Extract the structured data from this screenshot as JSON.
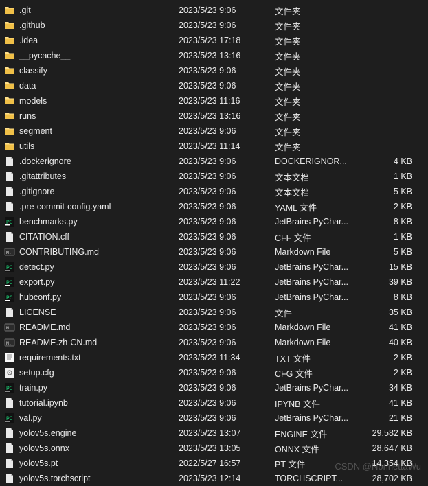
{
  "icons": {
    "folder": "folder",
    "file": "file",
    "pycharm": "pycharm",
    "markdown": "markdown",
    "text": "text",
    "config": "config"
  },
  "watermark": "CSDN @NonnettaWu",
  "rows": [
    {
      "icon": "folder",
      "name": ".git",
      "date": "2023/5/23 9:06",
      "type": "文件夹",
      "size": ""
    },
    {
      "icon": "folder",
      "name": ".github",
      "date": "2023/5/23 9:06",
      "type": "文件夹",
      "size": ""
    },
    {
      "icon": "folder",
      "name": ".idea",
      "date": "2023/5/23 17:18",
      "type": "文件夹",
      "size": ""
    },
    {
      "icon": "folder",
      "name": "__pycache__",
      "date": "2023/5/23 13:16",
      "type": "文件夹",
      "size": ""
    },
    {
      "icon": "folder",
      "name": "classify",
      "date": "2023/5/23 9:06",
      "type": "文件夹",
      "size": ""
    },
    {
      "icon": "folder",
      "name": "data",
      "date": "2023/5/23 9:06",
      "type": "文件夹",
      "size": ""
    },
    {
      "icon": "folder",
      "name": "models",
      "date": "2023/5/23 11:16",
      "type": "文件夹",
      "size": ""
    },
    {
      "icon": "folder",
      "name": "runs",
      "date": "2023/5/23 13:16",
      "type": "文件夹",
      "size": ""
    },
    {
      "icon": "folder",
      "name": "segment",
      "date": "2023/5/23 9:06",
      "type": "文件夹",
      "size": ""
    },
    {
      "icon": "folder",
      "name": "utils",
      "date": "2023/5/23 11:14",
      "type": "文件夹",
      "size": ""
    },
    {
      "icon": "file",
      "name": ".dockerignore",
      "date": "2023/5/23 9:06",
      "type": "DOCKERIGNOR...",
      "size": "4 KB"
    },
    {
      "icon": "file",
      "name": ".gitattributes",
      "date": "2023/5/23 9:06",
      "type": "文本文档",
      "size": "1 KB"
    },
    {
      "icon": "file",
      "name": ".gitignore",
      "date": "2023/5/23 9:06",
      "type": "文本文档",
      "size": "5 KB"
    },
    {
      "icon": "file",
      "name": ".pre-commit-config.yaml",
      "date": "2023/5/23 9:06",
      "type": "YAML 文件",
      "size": "2 KB"
    },
    {
      "icon": "pycharm",
      "name": "benchmarks.py",
      "date": "2023/5/23 9:06",
      "type": "JetBrains PyChar...",
      "size": "8 KB"
    },
    {
      "icon": "file",
      "name": "CITATION.cff",
      "date": "2023/5/23 9:06",
      "type": "CFF 文件",
      "size": "1 KB"
    },
    {
      "icon": "markdown",
      "name": "CONTRIBUTING.md",
      "date": "2023/5/23 9:06",
      "type": "Markdown File",
      "size": "5 KB"
    },
    {
      "icon": "pycharm",
      "name": "detect.py",
      "date": "2023/5/23 9:06",
      "type": "JetBrains PyChar...",
      "size": "15 KB"
    },
    {
      "icon": "pycharm",
      "name": "export.py",
      "date": "2023/5/23 11:22",
      "type": "JetBrains PyChar...",
      "size": "39 KB"
    },
    {
      "icon": "pycharm",
      "name": "hubconf.py",
      "date": "2023/5/23 9:06",
      "type": "JetBrains PyChar...",
      "size": "8 KB"
    },
    {
      "icon": "file",
      "name": "LICENSE",
      "date": "2023/5/23 9:06",
      "type": "文件",
      "size": "35 KB"
    },
    {
      "icon": "markdown",
      "name": "README.md",
      "date": "2023/5/23 9:06",
      "type": "Markdown File",
      "size": "41 KB"
    },
    {
      "icon": "markdown",
      "name": "README.zh-CN.md",
      "date": "2023/5/23 9:06",
      "type": "Markdown File",
      "size": "40 KB"
    },
    {
      "icon": "text",
      "name": "requirements.txt",
      "date": "2023/5/23 11:34",
      "type": "TXT 文件",
      "size": "2 KB"
    },
    {
      "icon": "config",
      "name": "setup.cfg",
      "date": "2023/5/23 9:06",
      "type": "CFG 文件",
      "size": "2 KB"
    },
    {
      "icon": "pycharm",
      "name": "train.py",
      "date": "2023/5/23 9:06",
      "type": "JetBrains PyChar...",
      "size": "34 KB"
    },
    {
      "icon": "file",
      "name": "tutorial.ipynb",
      "date": "2023/5/23 9:06",
      "type": "IPYNB 文件",
      "size": "41 KB"
    },
    {
      "icon": "pycharm",
      "name": "val.py",
      "date": "2023/5/23 9:06",
      "type": "JetBrains PyChar...",
      "size": "21 KB"
    },
    {
      "icon": "file",
      "name": "yolov5s.engine",
      "date": "2023/5/23 13:07",
      "type": "ENGINE 文件",
      "size": "29,582 KB"
    },
    {
      "icon": "file",
      "name": "yolov5s.onnx",
      "date": "2023/5/23 13:05",
      "type": "ONNX 文件",
      "size": "28,647 KB"
    },
    {
      "icon": "file",
      "name": "yolov5s.pt",
      "date": "2022/5/27 16:57",
      "type": "PT 文件",
      "size": "14,354 KB"
    },
    {
      "icon": "file",
      "name": "yolov5s.torchscript",
      "date": "2023/5/23 12:14",
      "type": "TORCHSCRIPT...",
      "size": "28,702 KB"
    }
  ]
}
